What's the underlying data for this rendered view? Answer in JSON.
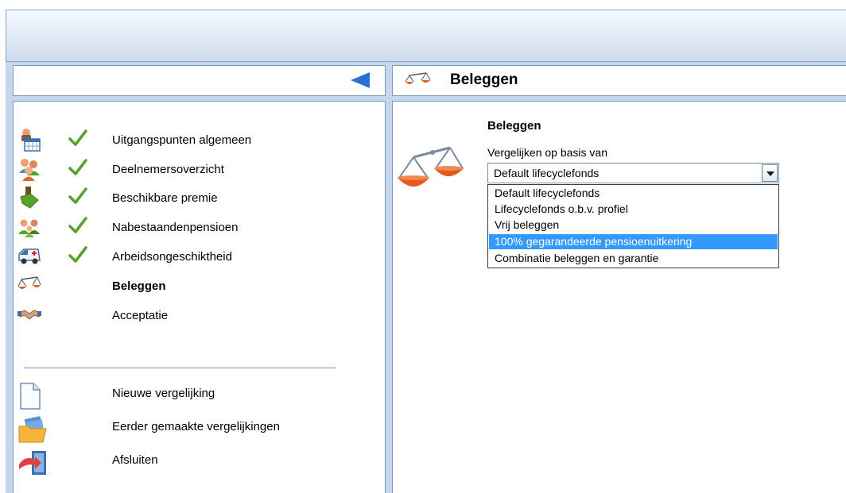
{
  "nav": {
    "items": [
      {
        "label": "Uitgangspunten algemeen",
        "icon": "calendar-person-icon",
        "checked": true
      },
      {
        "label": "Deelnemersoverzicht",
        "icon": "people-group-icon",
        "checked": true
      },
      {
        "label": "Beschikbare premie",
        "icon": "money-hand-icon",
        "checked": true
      },
      {
        "label": "Nabestaandenpensioen",
        "icon": "family-icon",
        "checked": true
      },
      {
        "label": "Arbeidsongeschiktheid",
        "icon": "ambulance-icon",
        "checked": true
      },
      {
        "label": "Beleggen",
        "icon": "scale-icon",
        "checked": false,
        "active": true
      },
      {
        "label": "Acceptatie",
        "icon": "handshake-icon",
        "checked": false
      }
    ],
    "actions": [
      {
        "label": "Nieuwe vergelijking",
        "icon": "new-document-icon"
      },
      {
        "label": "Eerder gemaakte vergelijkingen",
        "icon": "open-folder-icon"
      },
      {
        "label": "Afsluiten",
        "icon": "exit-door-icon"
      }
    ]
  },
  "content": {
    "header_title": "Beleggen",
    "section_title": "Beleggen",
    "field_label": "Vergelijken op basis van",
    "selected_value": "Default lifecyclefonds",
    "options": [
      "Default lifecyclefonds",
      "Lifecyclefonds o.b.v. profiel",
      "Vrij beleggen",
      "100% gegarandeerde pensioenuitkering",
      "Combinatie beleggen en garantie"
    ],
    "highlighted_option_index": 3
  },
  "colors": {
    "accent": "#3399ff",
    "frame": "#c5d7ee",
    "check": "#5aa02c"
  }
}
